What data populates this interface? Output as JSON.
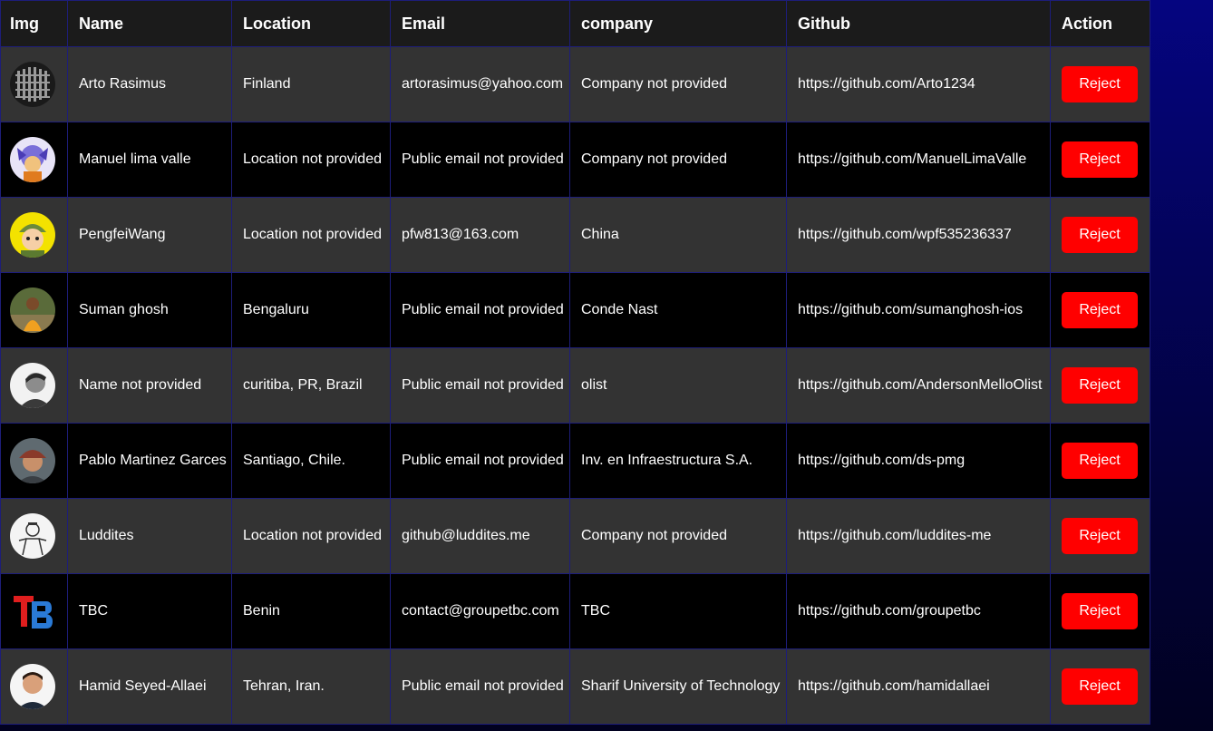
{
  "table": {
    "headers": [
      "Img",
      "Name",
      "Location",
      "Email",
      "company",
      "Github",
      "Action"
    ],
    "rows": [
      {
        "name": "Arto Rasimus",
        "location": "Finland",
        "email": "artorasimus@yahoo.com",
        "company": "Company not provided",
        "github": "https://github.com/Arto1234",
        "action": "Reject",
        "avatar_icon": "pixel-mosaic-avatar"
      },
      {
        "name": "Manuel lima valle",
        "location": "Location not provided",
        "email": "Public email not provided",
        "company": "Company not provided",
        "github": "https://github.com/ManuelLimaValle",
        "action": "Reject",
        "avatar_icon": "anime-character-avatar"
      },
      {
        "name": "PengfeiWang",
        "location": "Location not provided",
        "email": "pfw813@163.com",
        "company": "China",
        "github": "https://github.com/wpf535236337",
        "action": "Reject",
        "avatar_icon": "cartoon-soldier-avatar"
      },
      {
        "name": "Suman ghosh",
        "location": "Bengaluru",
        "email": "Public email not provided",
        "company": "Conde Nast",
        "github": "https://github.com/sumanghosh-ios",
        "action": "Reject",
        "avatar_icon": "person-photo-avatar"
      },
      {
        "name": "Name not provided",
        "location": "curitiba, PR, Brazil",
        "email": "Public email not provided",
        "company": "olist",
        "github": "https://github.com/AndersonMelloOlist",
        "action": "Reject",
        "avatar_icon": "grayscale-person-avatar"
      },
      {
        "name": "Pablo Martinez Garces",
        "location": "Santiago, Chile.",
        "email": "Public email not provided",
        "company": "Inv. en Infraestructura S.A.",
        "github": "https://github.com/ds-pmg",
        "action": "Reject",
        "avatar_icon": "person-cap-avatar"
      },
      {
        "name": "Luddites",
        "location": "Location not provided",
        "email": "github@luddites.me",
        "company": "Company not provided",
        "github": "https://github.com/luddites-me",
        "action": "Reject",
        "avatar_icon": "sketch-illustration-avatar"
      },
      {
        "name": "TBC",
        "location": "Benin",
        "email": "contact@groupetbc.com",
        "company": "TBC",
        "github": "https://github.com/groupetbc",
        "action": "Reject",
        "avatar_icon": "tbc-logo-avatar"
      },
      {
        "name": "Hamid Seyed-Allaei",
        "location": "Tehran, Iran.",
        "email": "Public email not provided",
        "company": "Sharif University of Technology",
        "github": "https://github.com/hamidallaei",
        "action": "Reject",
        "avatar_icon": "portrait-photo-avatar"
      }
    ]
  },
  "colors": {
    "reject_button": "#ff0000",
    "header_bg": "#1b1b1b",
    "row_light": "#333333",
    "row_dark": "#000000",
    "border": "#1d1d7a",
    "page_bg": "#050580"
  }
}
